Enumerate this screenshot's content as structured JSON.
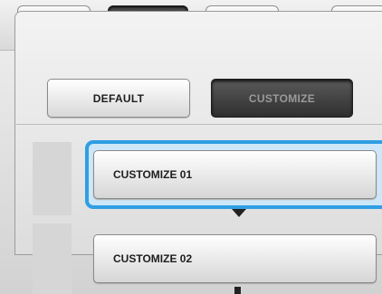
{
  "toolbar": {
    "items": [
      {
        "id": "pattern",
        "icon": "pattern-check-icon",
        "active": false
      },
      {
        "id": "machine",
        "icon": "sewing-machine-check-icon",
        "active": true
      },
      {
        "id": "embroidery",
        "icon": "embroidery-frame-check-icon",
        "active": false
      },
      {
        "id": "home",
        "icon": "home-icon",
        "active": false
      }
    ]
  },
  "mode": {
    "default_label": "DEFAULT",
    "customize_label": "CUSTOMIZE",
    "selected": "customize"
  },
  "list": {
    "items": [
      {
        "label": "CUSTOMIZE 01",
        "selected": true
      },
      {
        "label": "CUSTOMIZE 02",
        "selected": false
      }
    ]
  },
  "colors": {
    "selection": "#2f9ee3",
    "active_button": "#3a3a3a"
  }
}
